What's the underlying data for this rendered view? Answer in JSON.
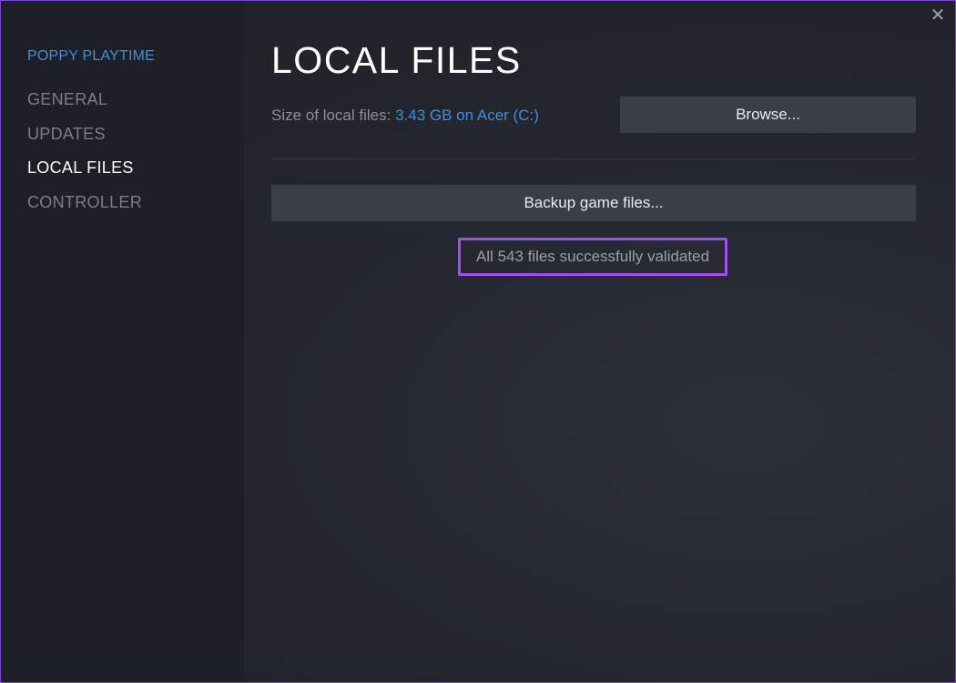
{
  "window": {
    "close_glyph": "✕"
  },
  "sidebar": {
    "game_title": "POPPY PLAYTIME",
    "items": [
      {
        "label": "GENERAL",
        "active": false
      },
      {
        "label": "UPDATES",
        "active": false
      },
      {
        "label": "LOCAL FILES",
        "active": true
      },
      {
        "label": "CONTROLLER",
        "active": false
      }
    ]
  },
  "main": {
    "title": "LOCAL FILES",
    "size_label": "Size of local files: ",
    "size_value": "3.43 GB on Acer (C:)",
    "browse_label": "Browse...",
    "backup_label": "Backup game files...",
    "status_text": "All 543 files successfully validated"
  },
  "colors": {
    "accent_blue": "#3d8fe0",
    "highlight_purple": "#a44df0",
    "window_border": "#7b45d8"
  },
  "icons": {
    "close": "close-icon"
  }
}
